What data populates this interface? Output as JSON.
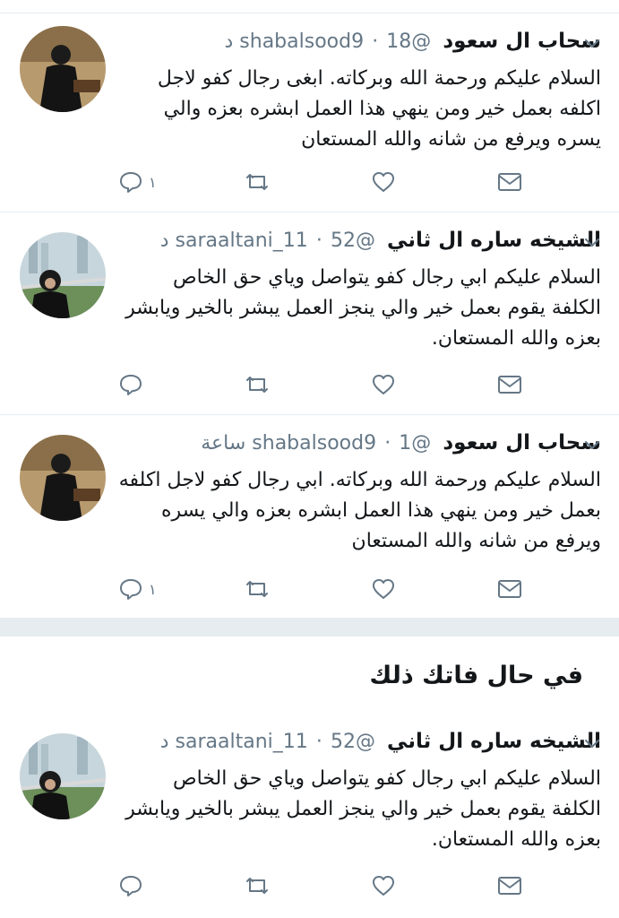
{
  "tweets": [
    {
      "display_name": "سحاب ال سعود",
      "handle": "@shabalsood9",
      "time": "18 د",
      "text": "السلام عليكم ورحمة الله وبركاته. ابغى رجال كفو لاجل اكلفه بعمل خير ومن ينهي هذا العمل ابشره بعزه والي يسره ويرفع من شانه والله المستعان",
      "reply_count": "١"
    },
    {
      "display_name": "الشيخه ساره ال ثاني",
      "handle": "@saraaltani_11",
      "time": "52 د",
      "text": "السلام عليكم ابي رجال كفو يتواصل وياي حق الخاص الكلفة  يقوم بعمل خير والي ينجز العمل يبشر بالخير ويابشر بعزه  والله المستعان.",
      "reply_count": ""
    },
    {
      "display_name": "سحاب ال سعود",
      "handle": "@shabalsood9",
      "time": "1 ساعة",
      "text": "السلام عليكم ورحمة الله وبركاته. ابي رجال كفو لاجل اكلفه بعمل خير ومن ينهي هذا العمل ابشره بعزه والي يسره ويرفع من شانه والله المستعان",
      "reply_count": "١"
    }
  ],
  "section_heading": "في حال فاتك ذلك",
  "highlight_tweet": {
    "display_name": "الشيخه ساره ال ثاني",
    "handle": "@saraaltani_11",
    "time": "52 د",
    "text": "السلام عليكم ابي رجال كفو يتواصل وياي حق الخاص الكلفة  يقوم بعمل خير والي ينجز العمل يبشر بالخير ويابشر بعزه  والله المستعان.",
    "reply_count": ""
  },
  "icons": [
    "reply-icon",
    "retweet-icon",
    "like-icon",
    "message-icon",
    "chevron-down-icon"
  ],
  "colors": {
    "icon": "#657786",
    "text": "#14171a",
    "muted": "#657786",
    "border": "#e6ecf0"
  }
}
